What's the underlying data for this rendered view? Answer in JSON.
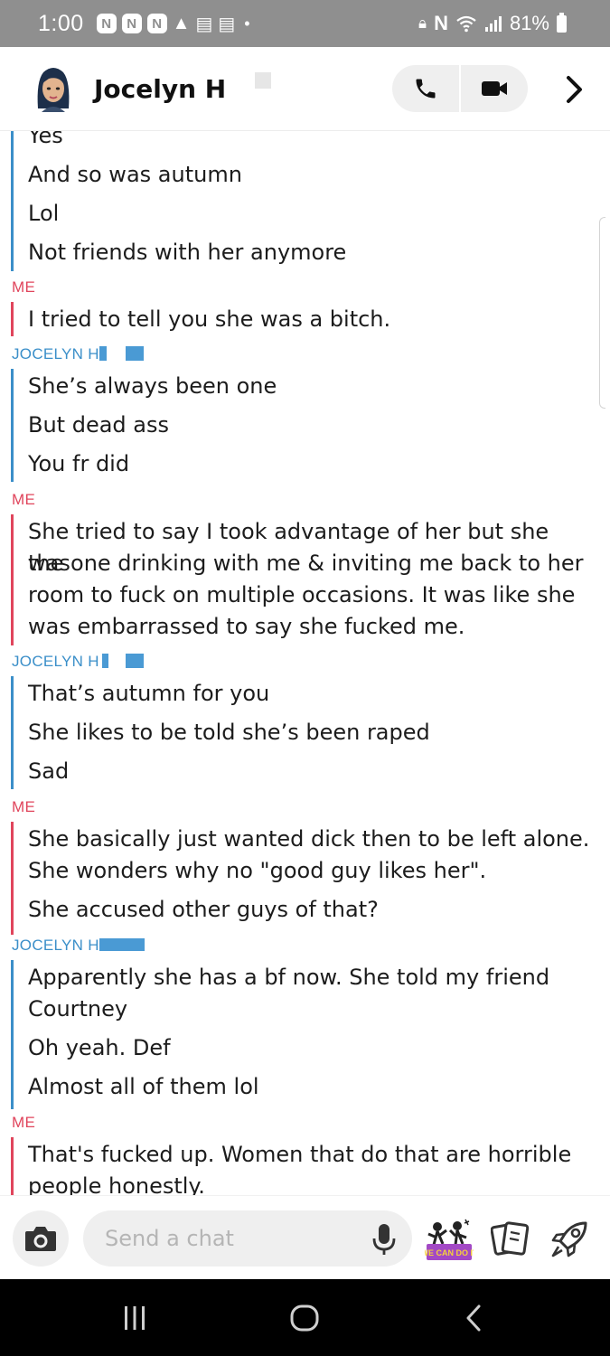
{
  "status_bar": {
    "time": "1:00",
    "battery": "81%",
    "notifications": [
      "N",
      "N",
      "N"
    ],
    "colors": {
      "background": "#8f8f8f",
      "text": "#ffffff"
    }
  },
  "header": {
    "contact_name": "Jocelyn H",
    "icons": [
      "bitmoji-avatar-icon",
      "phone-icon",
      "video-camera-icon",
      "chevron-right-icon"
    ]
  },
  "colors": {
    "me": "#e0455c",
    "friend": "#3b8fc9"
  },
  "messages": [
    {
      "sender": "",
      "lines": [
        "Yes",
        "And so was autumn",
        "Lol",
        "Not friends with her anymore"
      ]
    },
    {
      "sender": "ME",
      "lines": [
        "I tried to tell you she was a bitch."
      ]
    },
    {
      "sender": "JOCELYN H",
      "lines": [
        "She’s always been one",
        "But dead ass",
        "You fr did"
      ]
    },
    {
      "sender": "ME",
      "lines": [
        "She tried to say I took advantage of her but she was",
        "the one drinking with me & inviting me back to her",
        "room to fuck on multiple occasions. It was like she",
        "was embarrassed to say she fucked me."
      ]
    },
    {
      "sender": "JOCELYN H",
      "lines": [
        "That’s autumn for you",
        "She likes to be told she’s been raped",
        "Sad"
      ]
    },
    {
      "sender": "ME",
      "lines": [
        "She basically just wanted dick then to be left alone.",
        "She wonders why no \"good guy likes her\".",
        "She accused other guys of that?"
      ]
    },
    {
      "sender": "JOCELYN H",
      "lines": [
        "Apparently she has a bf now. She told my friend",
        "Courtney",
        "Oh yeah. Def",
        "Almost all of them lol"
      ]
    },
    {
      "sender": "ME",
      "lines": [
        "That's fucked up. Women that do that are horrible",
        "people honestly."
      ]
    }
  ],
  "input": {
    "placeholder": "Send a chat",
    "value": ""
  },
  "input_bar_icons": [
    "camera-icon",
    "microphone-icon",
    "bitmoji-sticker-icon",
    "cards-icon",
    "rocket-icon"
  ],
  "bitmoji_sticker_text": "WE CAN DO IT"
}
